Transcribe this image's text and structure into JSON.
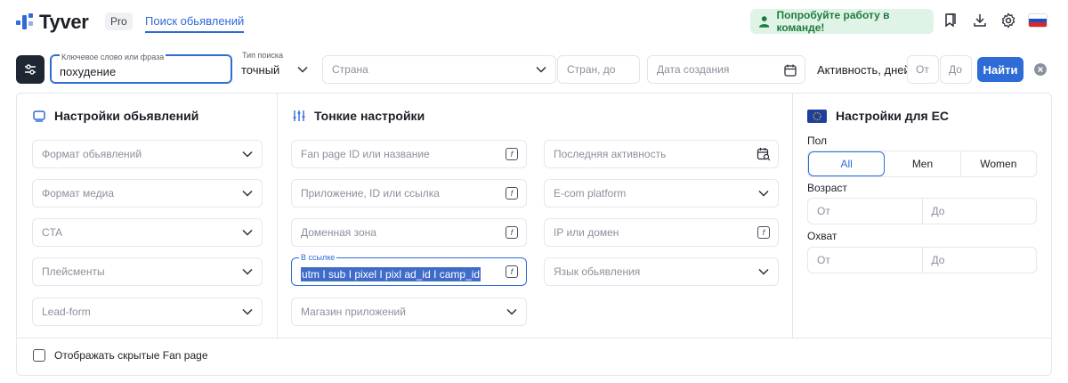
{
  "header": {
    "brand": "Tyver",
    "plan_badge": "Pro",
    "nav_link": "Поиск обьявлений",
    "team_button": "Попробуйте работу в команде!"
  },
  "search": {
    "keyword_label": "Ключевое слово или фраза",
    "keyword_value": "похудение",
    "type_label": "Тип поиска",
    "type_value": "точный",
    "country_placeholder": "Страна",
    "countries_to_placeholder": "Стран, до",
    "created_placeholder": "Дата создания",
    "activity_label": "Активность, дней",
    "from_placeholder": "От",
    "to_placeholder": "До",
    "find_button": "Найти"
  },
  "ad_settings": {
    "title": "Настройки обьявлений",
    "fields": [
      "Формат обьявлений",
      "Формат медиа",
      "CTA",
      "Плейсменты",
      "Lead-form"
    ]
  },
  "fine_settings": {
    "title": "Тонкие настройки",
    "left": [
      "Fan page ID или название",
      "Приложение, ID или ссылка",
      "Доменная зона"
    ],
    "link_label": "В ссылке",
    "link_value": "utm I sub I pixel I pixl ad_id I camp_id",
    "store": "Магазин приложений",
    "right": [
      "Последняя активность",
      "E-com platform",
      "IP или домен",
      "Язык обьявления"
    ]
  },
  "eu_settings": {
    "title": "Настройки для ЕС",
    "gender_label": "Пол",
    "gender_options": [
      "All",
      "Men",
      "Women"
    ],
    "age_label": "Возраст",
    "reach_label": "Охват",
    "from": "От",
    "to": "До"
  },
  "footer": {
    "hidden_fanpage": "Отображать скрытые Fan page"
  },
  "colors": {
    "accent": "#2e6bd6",
    "team_bg": "#dff4e6",
    "team_text": "#1f7a3f"
  }
}
